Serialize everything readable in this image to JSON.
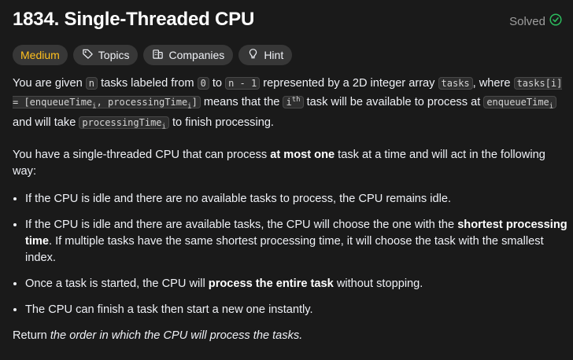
{
  "problem": {
    "title": "1834. Single-Threaded CPU",
    "status": "Solved",
    "difficulty": "Medium",
    "tags": {
      "topics": "Topics",
      "companies": "Companies",
      "hint": "Hint"
    }
  },
  "p1": {
    "t1": "You are given ",
    "c_n": "n",
    "t2": " tasks labeled from ",
    "c_0": "0",
    "t3": " to ",
    "c_nm1": "n - 1",
    "t4": " represented by a 2D integer array ",
    "c_tasks": "tasks",
    "t5": ", where ",
    "c_tasksi": "tasks[i] = [enqueueTime",
    "c_sub1": "i",
    "c_mid": ", processingTime",
    "c_sub2": "i",
    "c_end": "]",
    "t6": " means that the ",
    "c_i": "i",
    "c_sup": "th",
    "t7": " task will be available to process at ",
    "c_enq": "enqueueTime",
    "c_enq_sub": "i",
    "t8": " and will take ",
    "c_proc": "processingTime",
    "c_proc_sub": "i",
    "t9": " to finish processing."
  },
  "p2": {
    "t1": "You have a single-threaded CPU that can process ",
    "b1": "at most one",
    "t2": " task at a time and will act in the following way:"
  },
  "bullets": {
    "b1": "If the CPU is idle and there are no available tasks to process, the CPU remains idle.",
    "b2_t1": "If the CPU is idle and there are available tasks, the CPU will choose the one with the ",
    "b2_b": "shortest processing time",
    "b2_t2": ". If multiple tasks have the same shortest processing time, it will choose the task with the smallest index.",
    "b3_t1": "Once a task is started, the CPU will ",
    "b3_b": "process the entire task",
    "b3_t2": " without stopping.",
    "b4": "The CPU can finish a task then start a new one instantly."
  },
  "ret": {
    "t1": "Return ",
    "em": "the order in which the CPU will process the tasks."
  },
  "colors": {
    "difficulty": "#ffc01e",
    "solved_check": "#2cbb5d",
    "background": "#1a1a1a"
  }
}
